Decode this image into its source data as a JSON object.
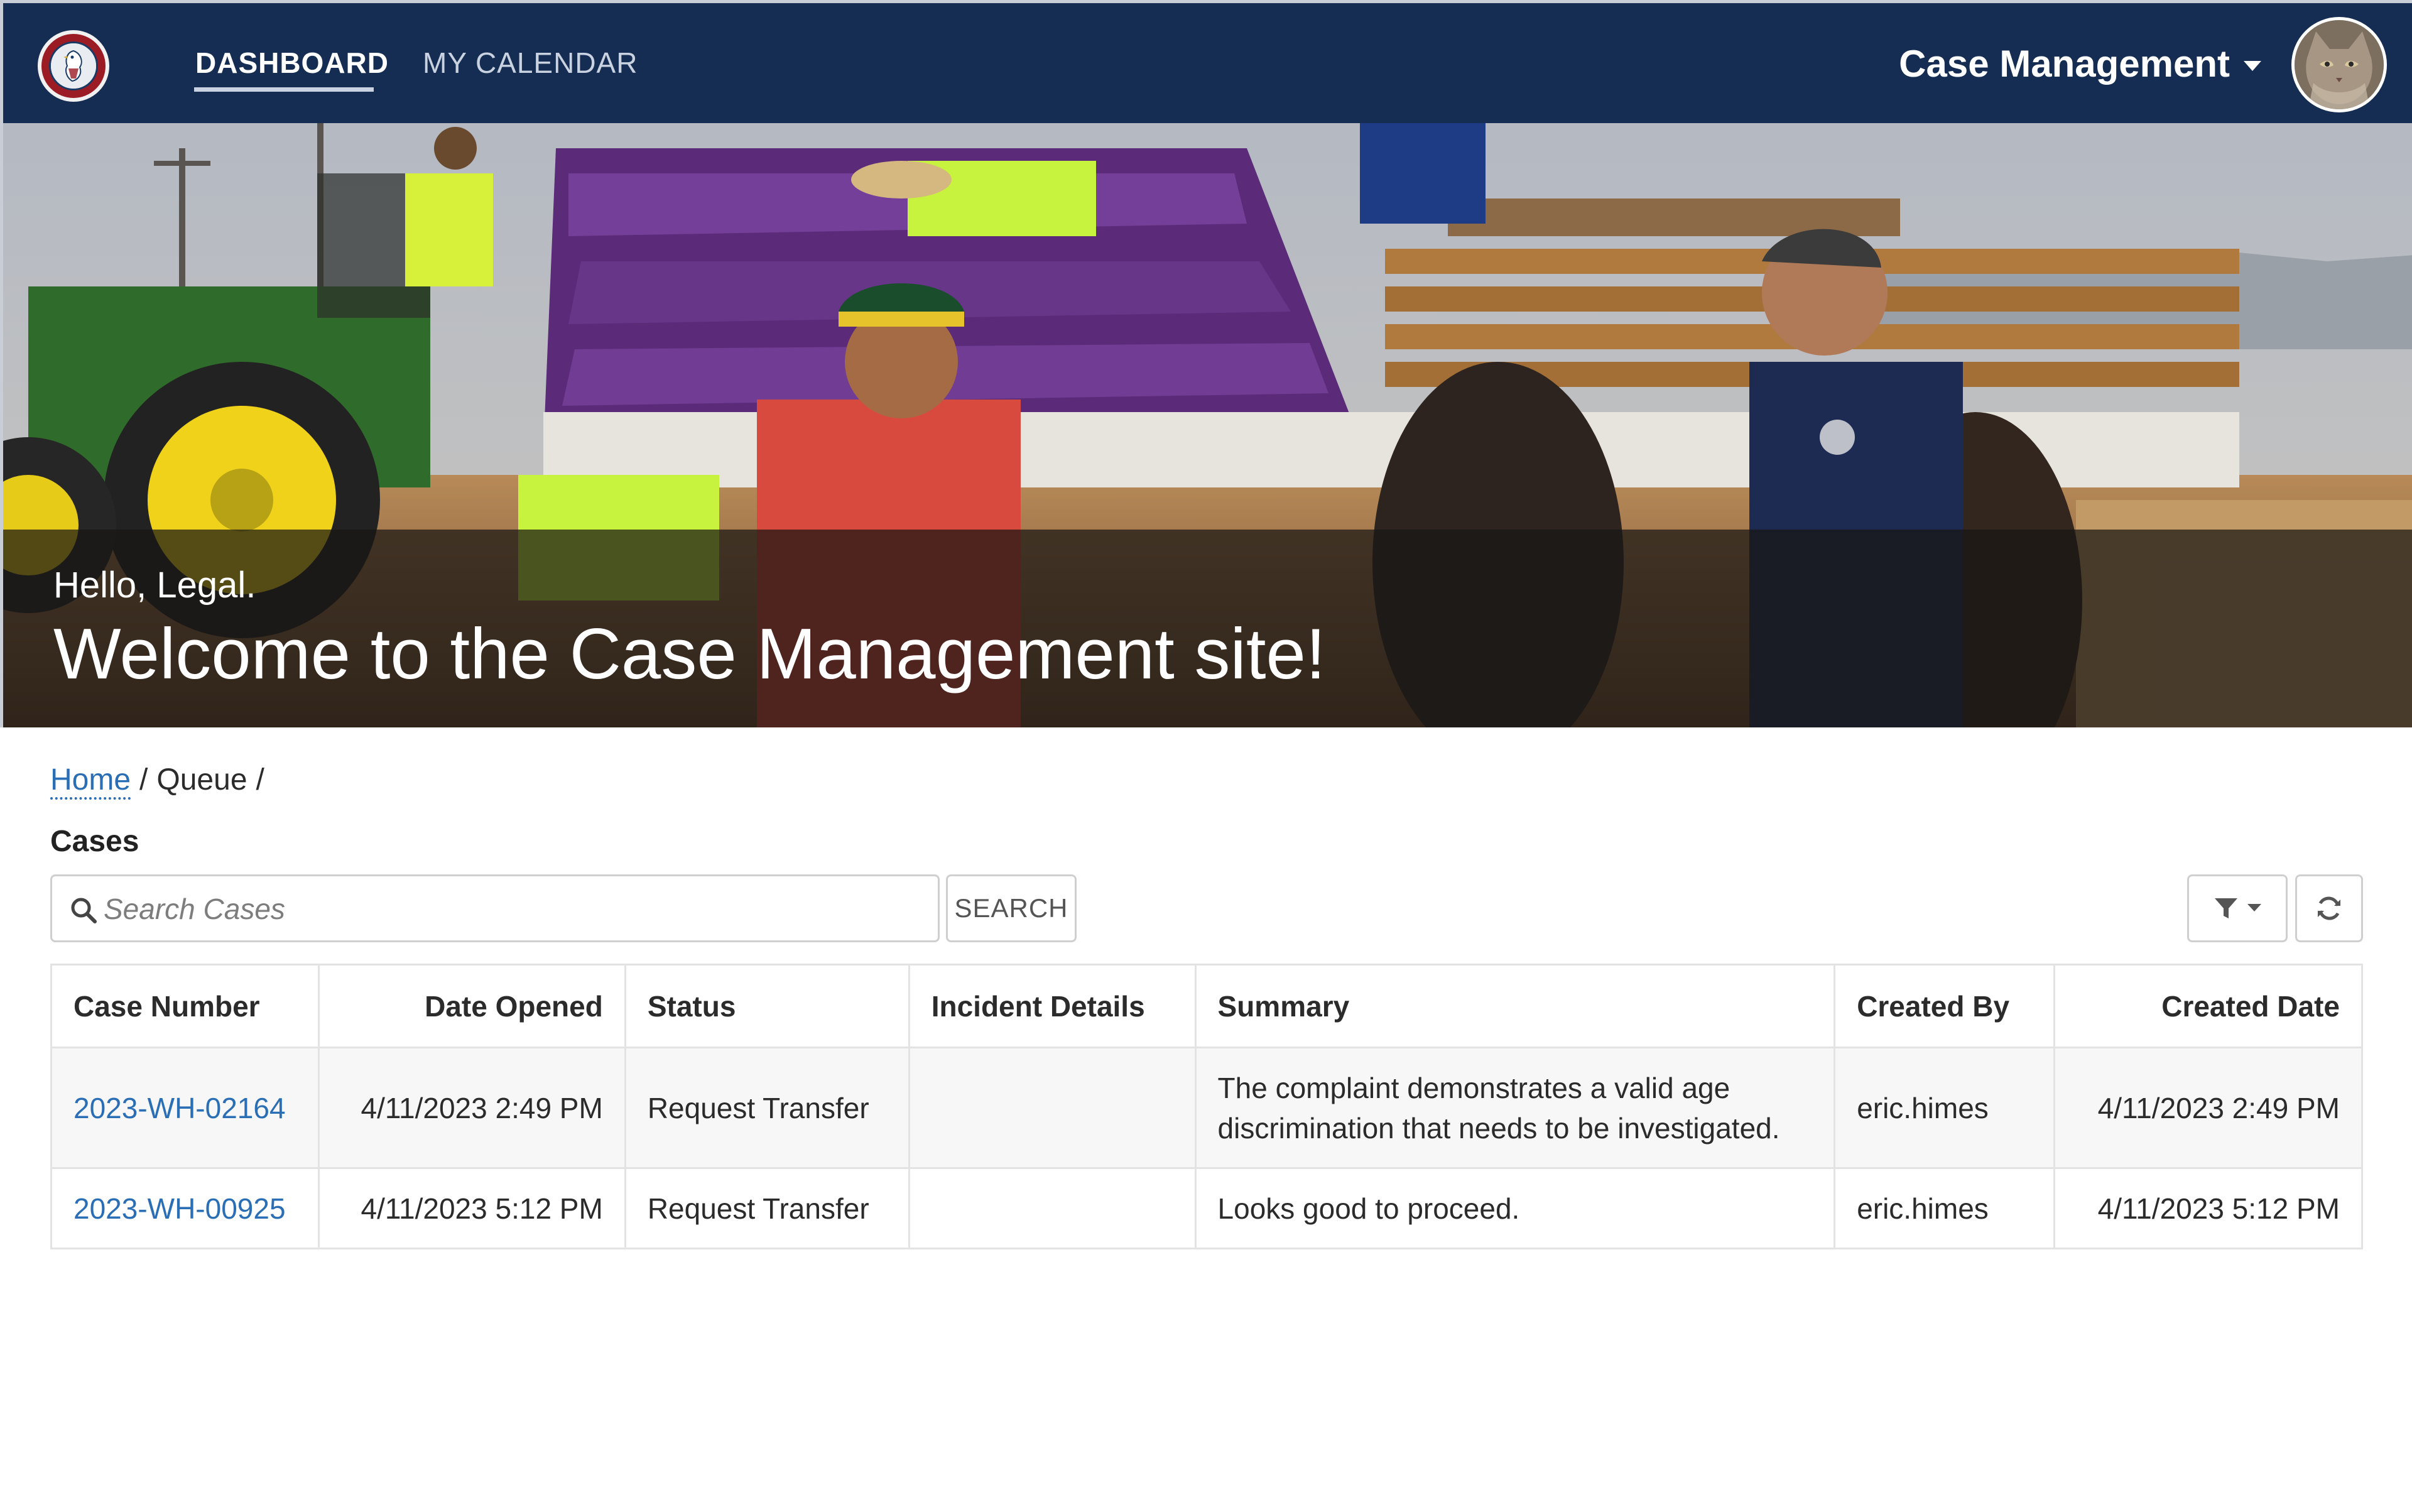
{
  "nav": {
    "items": [
      {
        "label": "DASHBOARD",
        "active": true
      },
      {
        "label": "MY CALENDAR",
        "active": false
      }
    ],
    "app_switcher": "Case Management",
    "logo": "eagle-seal-logo",
    "avatar": "cat-avatar"
  },
  "hero": {
    "greeting": "Hello, Legal.",
    "welcome": "Welcome to the Case Management site!"
  },
  "breadcrumb": {
    "home": "Home",
    "separator": "/",
    "current": "Queue"
  },
  "section_title": "Cases",
  "search": {
    "placeholder": "Search Cases",
    "value": "",
    "button_label": "SEARCH"
  },
  "toolbar": {
    "filter_icon": "filter-icon",
    "refresh_icon": "refresh-icon"
  },
  "table": {
    "columns": [
      "Case Number",
      "Date Opened",
      "Status",
      "Incident Details",
      "Summary",
      "Created By",
      "Created Date"
    ],
    "rows": [
      {
        "case_number": "2023-WH-02164",
        "date_opened": "4/11/2023 2:49 PM",
        "status": "Request Transfer",
        "incident_details": "",
        "summary_line1": "The complaint demonstrates a valid age",
        "summary_line2": "discrimination that needs to be investigated.",
        "created_by": "eric.himes",
        "created_date": "4/11/2023 2:49 PM"
      },
      {
        "case_number": "2023-WH-00925",
        "date_opened": "4/11/2023 5:12 PM",
        "status": "Request Transfer",
        "incident_details": "",
        "summary_line1": "Looks good to proceed.",
        "summary_line2": "",
        "created_by": "eric.himes",
        "created_date": "4/11/2023 5:12 PM"
      }
    ]
  },
  "colors": {
    "nav_background": "#152d52",
    "link": "#2a6eb5",
    "hero_overlay": "#191614"
  }
}
